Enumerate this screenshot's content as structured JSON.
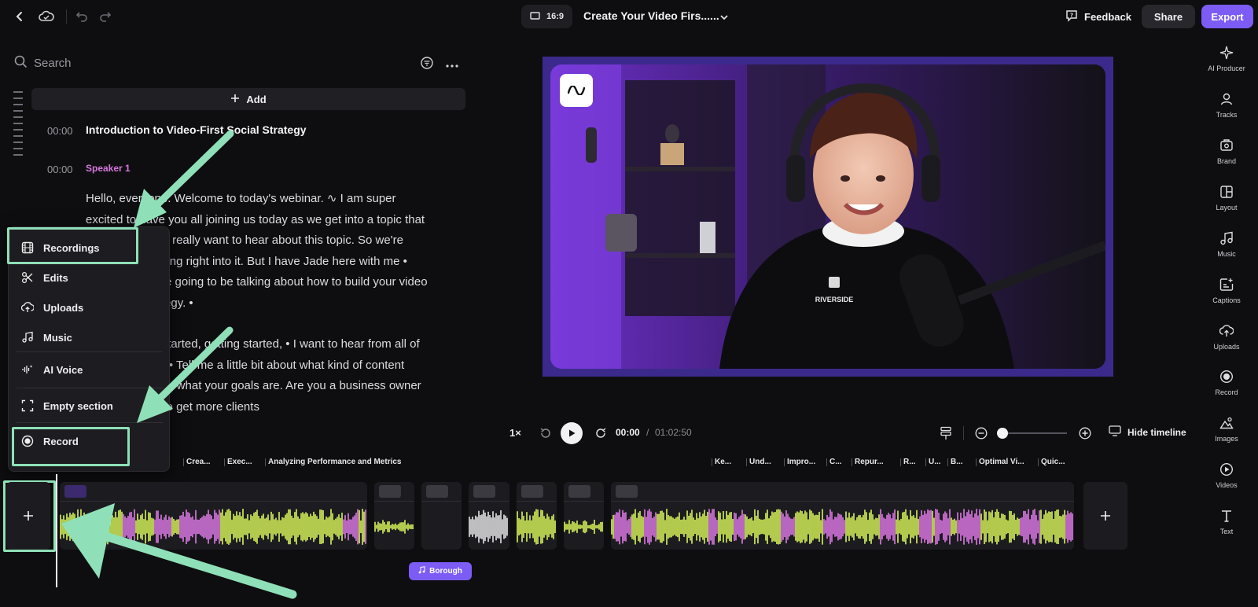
{
  "topbar": {
    "aspect_ratio": "16:9",
    "project_title": "Create Your Video Firs......",
    "feedback_label": "Feedback",
    "share_label": "Share",
    "export_label": "Export"
  },
  "left_panel": {
    "search_placeholder": "Search",
    "add_label": "Add",
    "section_timestamp": "00:00",
    "section_title": "Introduction to Video-First Social Strategy",
    "speaker_timestamp": "00:00",
    "speaker_name": "Speaker 1",
    "transcript": [
      "Hello, everyone. Welcome to today's webinar. ∿ I am super excited to have you all joining us today as we get into a topic that so many people really want to hear about this topic. So we're going to be getting right into it. But I have Jade here with me • today. And we're going to be talking about how to build your video first social strategy. •",
      "Before we get started, getting started, • I want to hear from all of you in the chat. • Tell me a little bit about what kind of content you're creating, • what your goals are. Are you a business owner who is looking to get more clients"
    ]
  },
  "add_menu": {
    "items": [
      {
        "label": "Recordings",
        "icon": "film-icon"
      },
      {
        "label": "Edits",
        "icon": "scissors-icon"
      },
      {
        "label": "Uploads",
        "icon": "cloud-upload-icon"
      },
      {
        "label": "Music",
        "icon": "music-note-icon"
      },
      {
        "label": "AI Voice",
        "icon": "ai-voice-icon"
      },
      {
        "label": "Empty section",
        "icon": "dashed-square-icon"
      },
      {
        "label": "Record",
        "icon": "record-icon"
      }
    ]
  },
  "video": {
    "shirt_text": "RIVERSIDE"
  },
  "player": {
    "speed": "1×",
    "current_time": "00:00",
    "separator": "/",
    "total_time": "01:02:50",
    "hide_timeline_label": "Hide timeline",
    "zoom_level": 0.0
  },
  "timeline": {
    "chapters": [
      "Crea...",
      "Exec...",
      "Analyzing Performance and Metrics",
      "Ke...",
      "Und...",
      "Impro...",
      "C...",
      "Repur...",
      "R...",
      "U...",
      "B...",
      "Optimal Vi...",
      "Quic..."
    ],
    "music_chip_label": "Borough"
  },
  "right_sidebar": {
    "items": [
      {
        "label": "AI Producer",
        "icon": "sparkle-icon"
      },
      {
        "label": "Tracks",
        "icon": "people-icon"
      },
      {
        "label": "Brand",
        "icon": "brand-icon"
      },
      {
        "label": "Layout",
        "icon": "layout-icon"
      },
      {
        "label": "Music",
        "icon": "music-icon"
      },
      {
        "label": "Captions",
        "icon": "captions-icon"
      },
      {
        "label": "Uploads",
        "icon": "upload-icon"
      },
      {
        "label": "Record",
        "icon": "record-icon"
      },
      {
        "label": "Images",
        "icon": "images-icon"
      },
      {
        "label": "Videos",
        "icon": "videos-icon"
      },
      {
        "label": "Text",
        "icon": "text-icon"
      }
    ]
  },
  "colors": {
    "accent": "#7c5cf5",
    "highlight": "#8fe0b8",
    "waveform_green": "#d8f55a",
    "waveform_pink": "#e07ae8",
    "speaker": "#d877e0"
  }
}
